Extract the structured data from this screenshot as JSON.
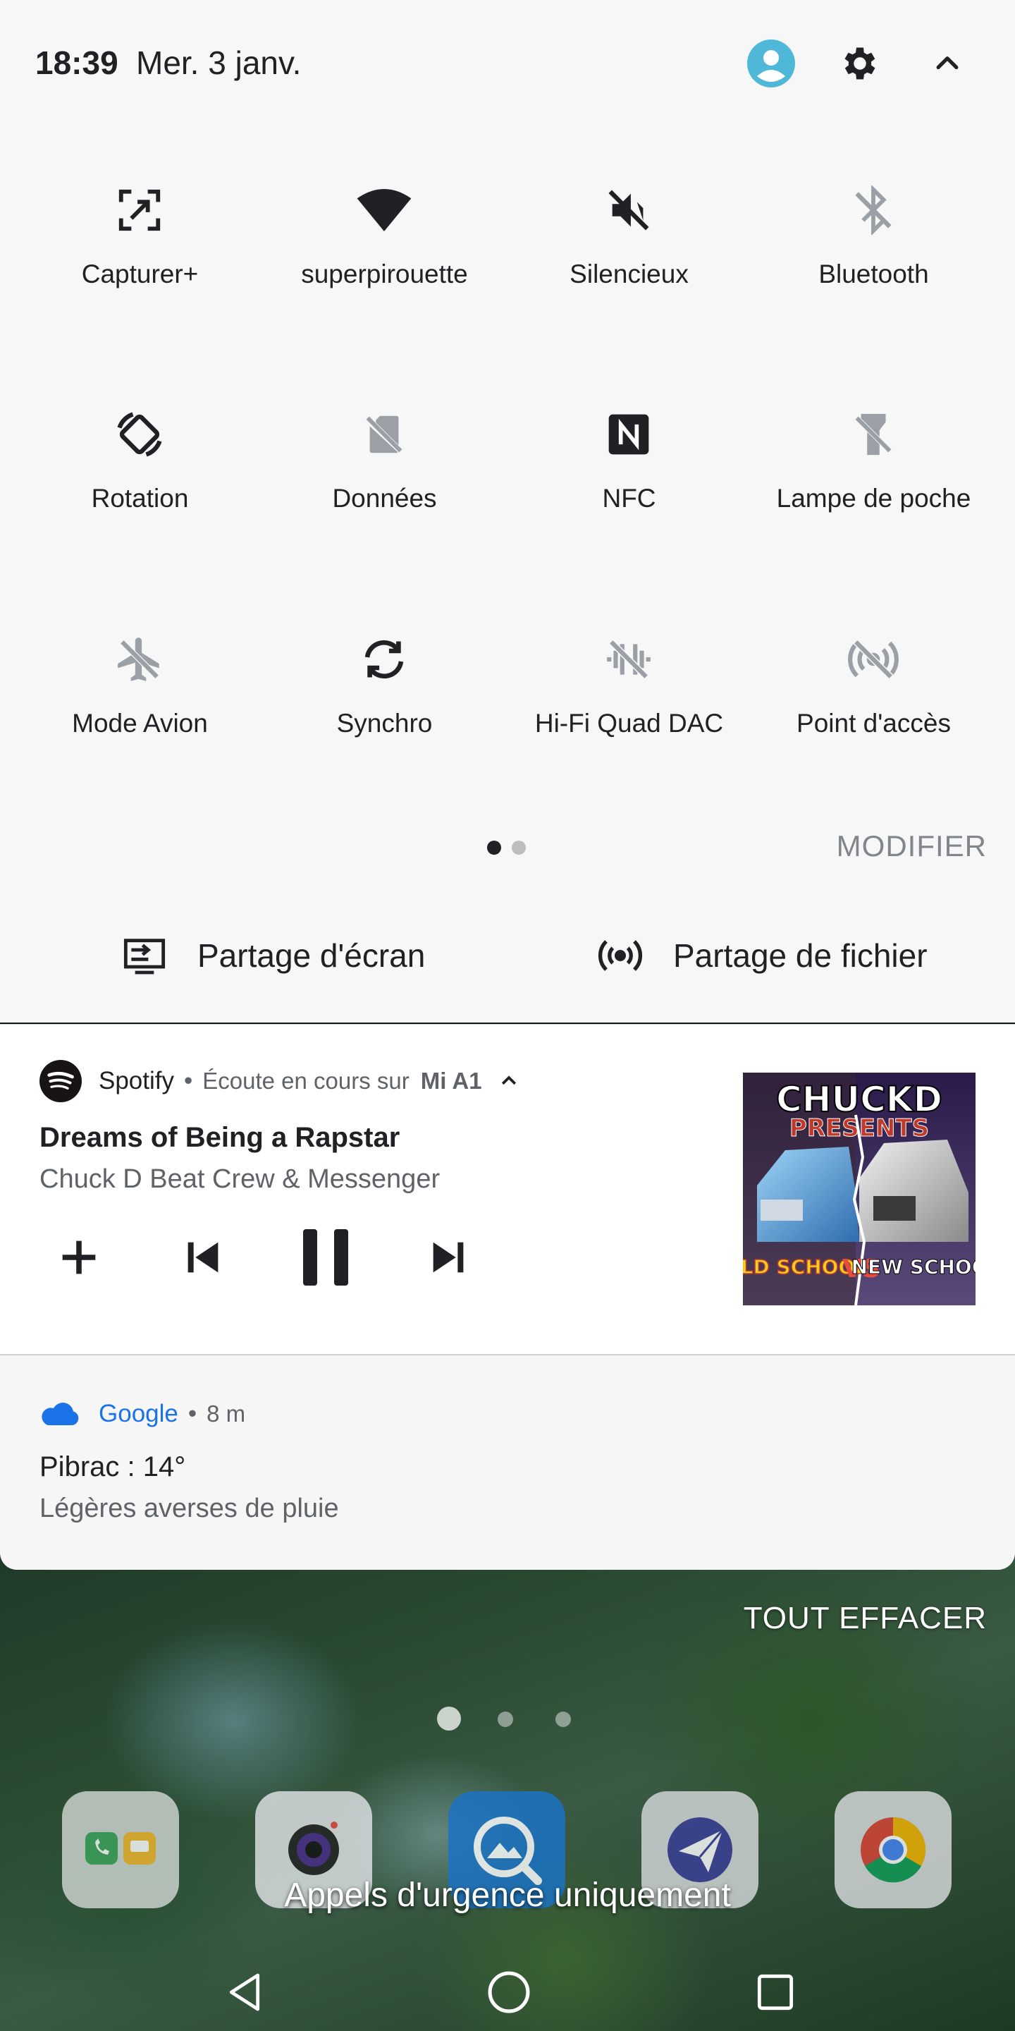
{
  "status": {
    "time": "18:39",
    "date": "Mer. 3 janv."
  },
  "quick_settings": {
    "tiles": [
      {
        "label": "Capturer+",
        "icon": "screenshot-capture-icon",
        "active": true
      },
      {
        "label": "superpirouette",
        "icon": "wifi-icon",
        "active": true
      },
      {
        "label": "Silencieux",
        "icon": "volume-mute-icon",
        "active": true
      },
      {
        "label": "Bluetooth",
        "icon": "bluetooth-off-icon",
        "active": false
      },
      {
        "label": "Rotation",
        "icon": "auto-rotate-icon",
        "active": true
      },
      {
        "label": "Données",
        "icon": "mobile-data-off-icon",
        "active": false
      },
      {
        "label": "NFC",
        "icon": "nfc-icon",
        "active": true
      },
      {
        "label": "Lampe de poche",
        "icon": "flashlight-off-icon",
        "active": false
      },
      {
        "label": "Mode Avion",
        "icon": "airplane-off-icon",
        "active": false
      },
      {
        "label": "Synchro",
        "icon": "sync-icon",
        "active": true
      },
      {
        "label": "Hi-Fi Quad DAC",
        "icon": "hifi-dac-off-icon",
        "active": false
      },
      {
        "label": "Point d'accès",
        "icon": "hotspot-off-icon",
        "active": false
      }
    ],
    "modify_label": "MODIFIER",
    "screen_share_label": "Partage d'écran",
    "file_share_label": "Partage de fichier"
  },
  "media_notification": {
    "app_name": "Spotify",
    "separator": "•",
    "casting_text": "Écoute en cours sur",
    "device_name": "Mi A1",
    "track_title": "Dreams of Being a Rapstar",
    "track_artist": "Chuck D Beat Crew & Messenger",
    "album_art_top": "CHUCKD",
    "album_art_sub": "PRESENTS",
    "album_art_left": "OLD SCHOOL",
    "album_art_vs": "VS",
    "album_art_right": "NEW SCHOOL"
  },
  "weather_notification": {
    "app_name": "Google",
    "separator": "•",
    "time_ago": "8 m",
    "title": "Pibrac : 14°",
    "description": "Légères averses de pluie"
  },
  "clear_all_label": "TOUT EFFACER",
  "emergency_text": "Appels d'urgence uniquement",
  "colors": {
    "panel_background": "#f7f7f8",
    "icon_active": "#202124",
    "icon_inactive": "#9aa0a6",
    "user_accent": "#4fb8d8",
    "google_blue": "#1a73e8",
    "spotify_black": "#191414"
  }
}
